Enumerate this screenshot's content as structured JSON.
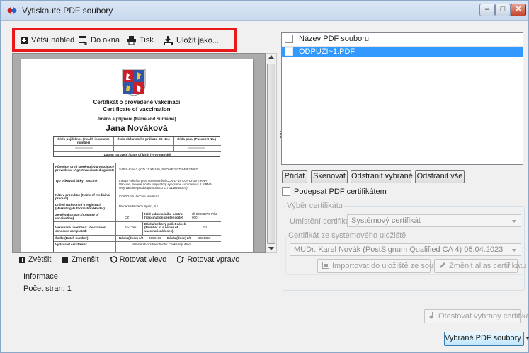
{
  "window": {
    "title": "Vytisknuté PDF soubory",
    "minimize": "‒",
    "maximize": "□",
    "close": "✕"
  },
  "toolbar": {
    "bigger_preview": "Větší náhled",
    "fit_window": "Do okna",
    "print": "Tisk...",
    "save_as": "Uložit jako..."
  },
  "document": {
    "title_cz": "Certifikát o provedené vakcinaci",
    "title_en": "Certificate of vaccination",
    "name_label": "Jméno a příjmení (Name and Surname)",
    "name": "Jana Nováková",
    "head_cols": [
      "Číslo pojištěnce (Health insurance number)",
      "Číslo občanského průkazu (ID No.)",
      "Číslo pasu (Passport No.)"
    ],
    "dob_label": "Datum narození / Date of birth (yyyy-mm-dd)",
    "rows": [
      {
        "label": "Původce, proti kterému byla vakcinace provedena: (Agent vaccinated against)",
        "value": "SARS-CoV-2 (ICD 11 XN109, SNOMED CT 840533007)"
      },
      {
        "label": "Typ očkovací látky: Vaccine:",
        "value": "mRNA vakcína proti onemocnění COVID-19 COVID-19 mRNA Vaccine, Severe acute respiratory syndrome coronavirus 2 mRNA only vaccine product(SNOMED CT 1119349007)"
      },
      {
        "label": "Název produktu: (Name of medicinal product)",
        "value": "COVID-19 Vaccine Moderna"
      },
      {
        "label": "Držitel rozhodnutí o registraci: (Marketing Authorization Holder)",
        "value": "Moderna Biotech Spain, S.L."
      },
      {
        "label": "Země vakcinace: (Country of vaccination)",
        "value": "CZ"
      },
      {
        "label": "Vakcinace ukončena: Vaccination schedule completed:",
        "value": "Ano Yes"
      },
      {
        "label": "Šarže (Batch number)",
        "value": "Dávka(dose) 1/2"
      },
      {
        "label": "Vydavatel certifikátu:",
        "value": "Ministerstvo zdravotnictví České republiky"
      }
    ],
    "center_label": "Kód vakcinačního centra: (Vaccination center code)",
    "center_value": "IČ 03983975 PČZ 000",
    "dose_label": "Dávka/celkový počet dávek (Number in a series of vaccination/doses)",
    "dose_value": "2/2",
    "batch1": "3003406",
    "dose2": "Dávka(dose) 2/2",
    "batch2": "3001659"
  },
  "zoom": {
    "zoom_in": "Zvětšit",
    "zoom_out": "Zmenšit",
    "rotate_left": "Rotovat vlevo",
    "rotate_right": "Rotovat vpravo"
  },
  "info": {
    "title": "Informace",
    "pages": "Počet stran: 1"
  },
  "filelist": {
    "header": "Název PDF souboru",
    "files": [
      "ODPUZI~1.PDF"
    ]
  },
  "buttons": {
    "add": "Přidat",
    "scan": "Skenovat",
    "remove_selected": "Odstranit vybrané",
    "remove_all": "Odstranit vše"
  },
  "sign": {
    "label": "Podepsat PDF certifikátem"
  },
  "cert": {
    "group_title": "Výběr certifikátu",
    "location_label": "Umístění certifikátu",
    "location_value": "Systémový certifikát",
    "store_label": "Certifikát ze systémového uložiště",
    "store_value": "MUDr. Karel Novák (PostSignum Qualified CA 4) 05.04.2023",
    "import_button": "Importovat do uložiště ze souboru",
    "alias_button": "Změnit alias certifikátu",
    "test_button": "Otestovat vybraný certifikát"
  },
  "footer": {
    "selected_files": "Vybrané PDF soubory"
  }
}
